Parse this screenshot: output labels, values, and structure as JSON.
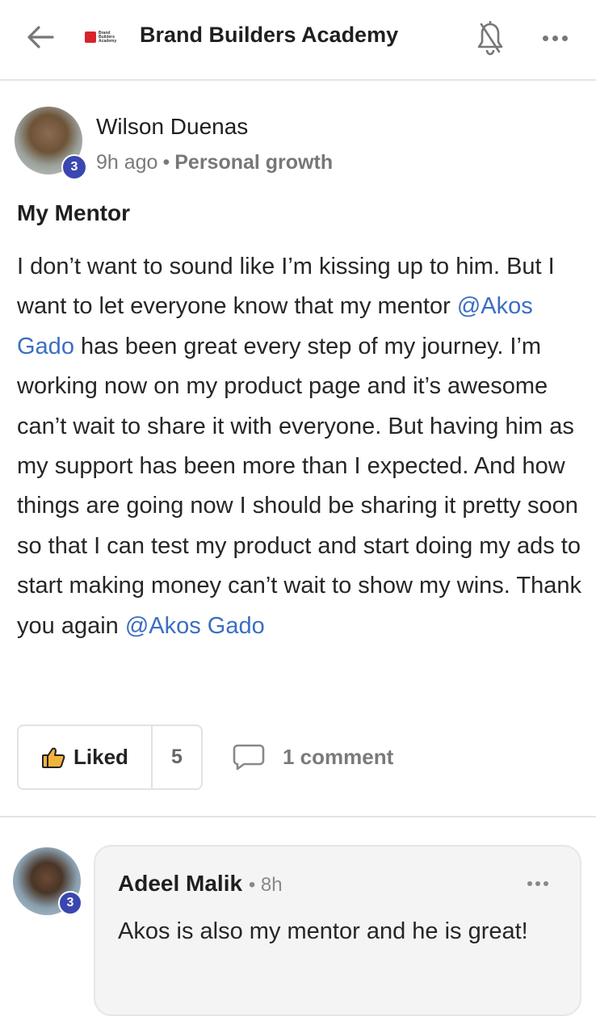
{
  "header": {
    "back_icon": "arrow-left-icon",
    "logo_text": "Brand Builders Academy",
    "title": "Brand Builders Academy",
    "bell_icon": "bell-off-icon",
    "menu_icon": "more-horizontal-icon"
  },
  "post": {
    "author": "Wilson Duenas",
    "author_level": "3",
    "time": "9h ago",
    "separator": "•",
    "category": "Personal growth",
    "title": "My Mentor",
    "body_parts": [
      "I don’t want to sound like I’m kissing up to him. But I want to let everyone know that my mentor ",
      "@Akos Gado",
      " has been great every step of my journey. I’m working now on my product page and it’s awesome can’t wait to share it with everyone. But having him as my support has been more than I expected. And how things are going now I should be sharing it pretty soon so that I can test my product and start doing my ads to start making money can’t wait to show my wins. Thank you again ",
      "@Akos Gado"
    ],
    "like_icon": "thumbs-up-icon",
    "like_label": "Liked",
    "like_count": "5",
    "comment_icon": "comment-icon",
    "comment_label": "1 comment"
  },
  "comment": {
    "author": "Adeel Malik",
    "author_level": "3",
    "time": "• 8h",
    "text": "Akos is also my mentor and he is great!",
    "menu_icon": "more-horizontal-icon"
  },
  "colors": {
    "mention": "#3b6ec2",
    "badge": "#3a47b0",
    "logo_red": "#d8242c"
  }
}
